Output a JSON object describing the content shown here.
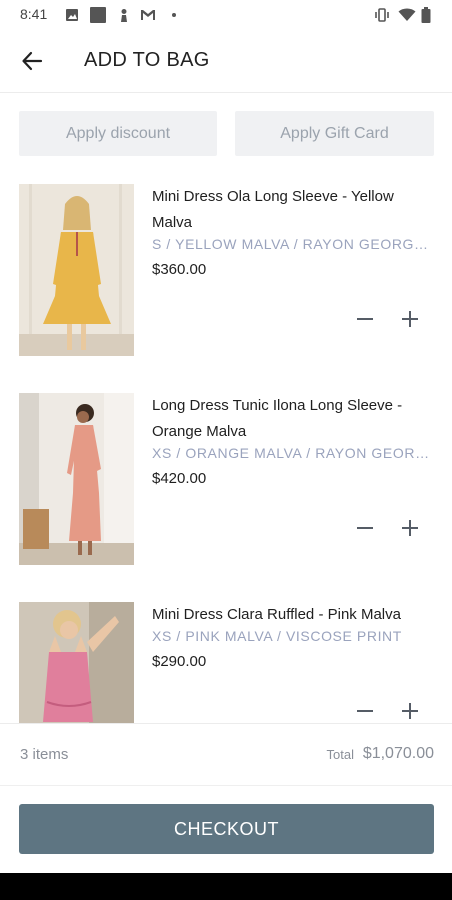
{
  "status_bar": {
    "time": "8:41",
    "left_icons": [
      "image-icon",
      "square-icon",
      "person-icon",
      "gmail-icon",
      "dot-icon"
    ],
    "right_icons": [
      "vibrate-icon",
      "wifi-icon",
      "battery-icon"
    ]
  },
  "header": {
    "title": "ADD TO BAG",
    "back_icon": "back-arrow-icon"
  },
  "discount": {
    "apply_discount_label": "Apply discount",
    "apply_gift_card_label": "Apply Gift Card"
  },
  "items": [
    {
      "name": "Mini Dress Ola Long Sleeve - Yellow Malva",
      "variant": "S / YELLOW MALVA / RAYON GEORGETTE...",
      "price": "$360.00",
      "dress_color": "#e8b64a"
    },
    {
      "name": "Long Dress Tunic Ilona Long Sleeve - Orange Malva",
      "variant": "XS / ORANGE MALVA / RAYON GEORGETT...",
      "price": "$420.00",
      "dress_color": "#e59a86"
    },
    {
      "name": "Mini Dress Clara Ruffled - Pink Malva",
      "variant": "XS / PINK MALVA / VISCOSE PRINT",
      "price": "$290.00",
      "dress_color": "#e07f9c"
    }
  ],
  "summary": {
    "count": "3 items",
    "total_label": "Total",
    "total_value": "$1,070.00"
  },
  "checkout": {
    "label": "CHECKOUT"
  },
  "colors": {
    "accent": "#5e7582",
    "variant_text": "#9aa3bd",
    "soft_button_bg": "#f0f1f3"
  }
}
